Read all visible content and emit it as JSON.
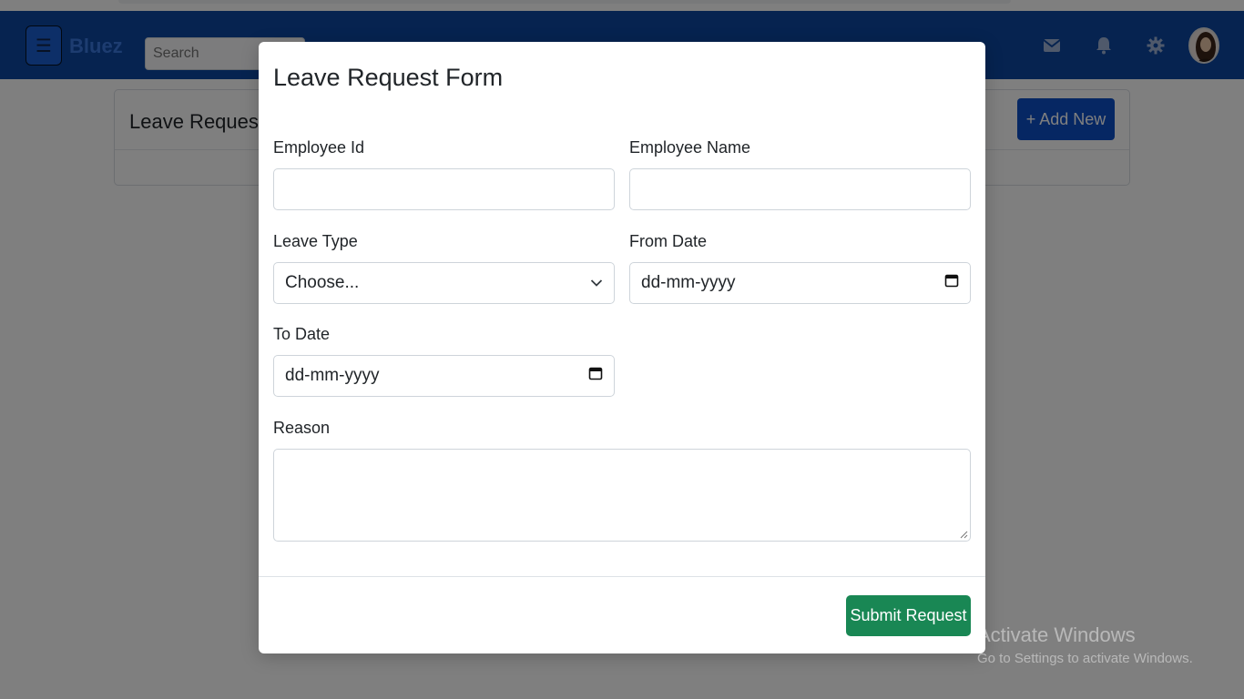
{
  "navbar": {
    "brand": "Bluez",
    "search_placeholder": "Search",
    "icons": [
      "menu-icon",
      "mail-icon",
      "bell-icon",
      "gear-icon",
      "avatar"
    ],
    "background_color": "#0d47a1"
  },
  "page": {
    "card_title": "Leave Request F",
    "add_new_label": "+ Add New"
  },
  "modal": {
    "title": "Leave Request Form",
    "fields": {
      "employee_id": {
        "label": "Employee Id",
        "value": ""
      },
      "employee_name": {
        "label": "Employee Name",
        "value": ""
      },
      "leave_type": {
        "label": "Leave Type",
        "value": "Choose..."
      },
      "from_date": {
        "label": "From Date",
        "value": "dd-mm-yyyy"
      },
      "to_date": {
        "label": "To Date",
        "value": "dd-mm-yyyy"
      },
      "reason": {
        "label": "Reason",
        "value": ""
      }
    },
    "submit_label": "Submit Request"
  },
  "watermark": {
    "title": "Activate Windows",
    "subtitle": "Go to Settings to activate Windows."
  },
  "colors": {
    "primary": "#0d4fc7",
    "success": "#198754"
  }
}
